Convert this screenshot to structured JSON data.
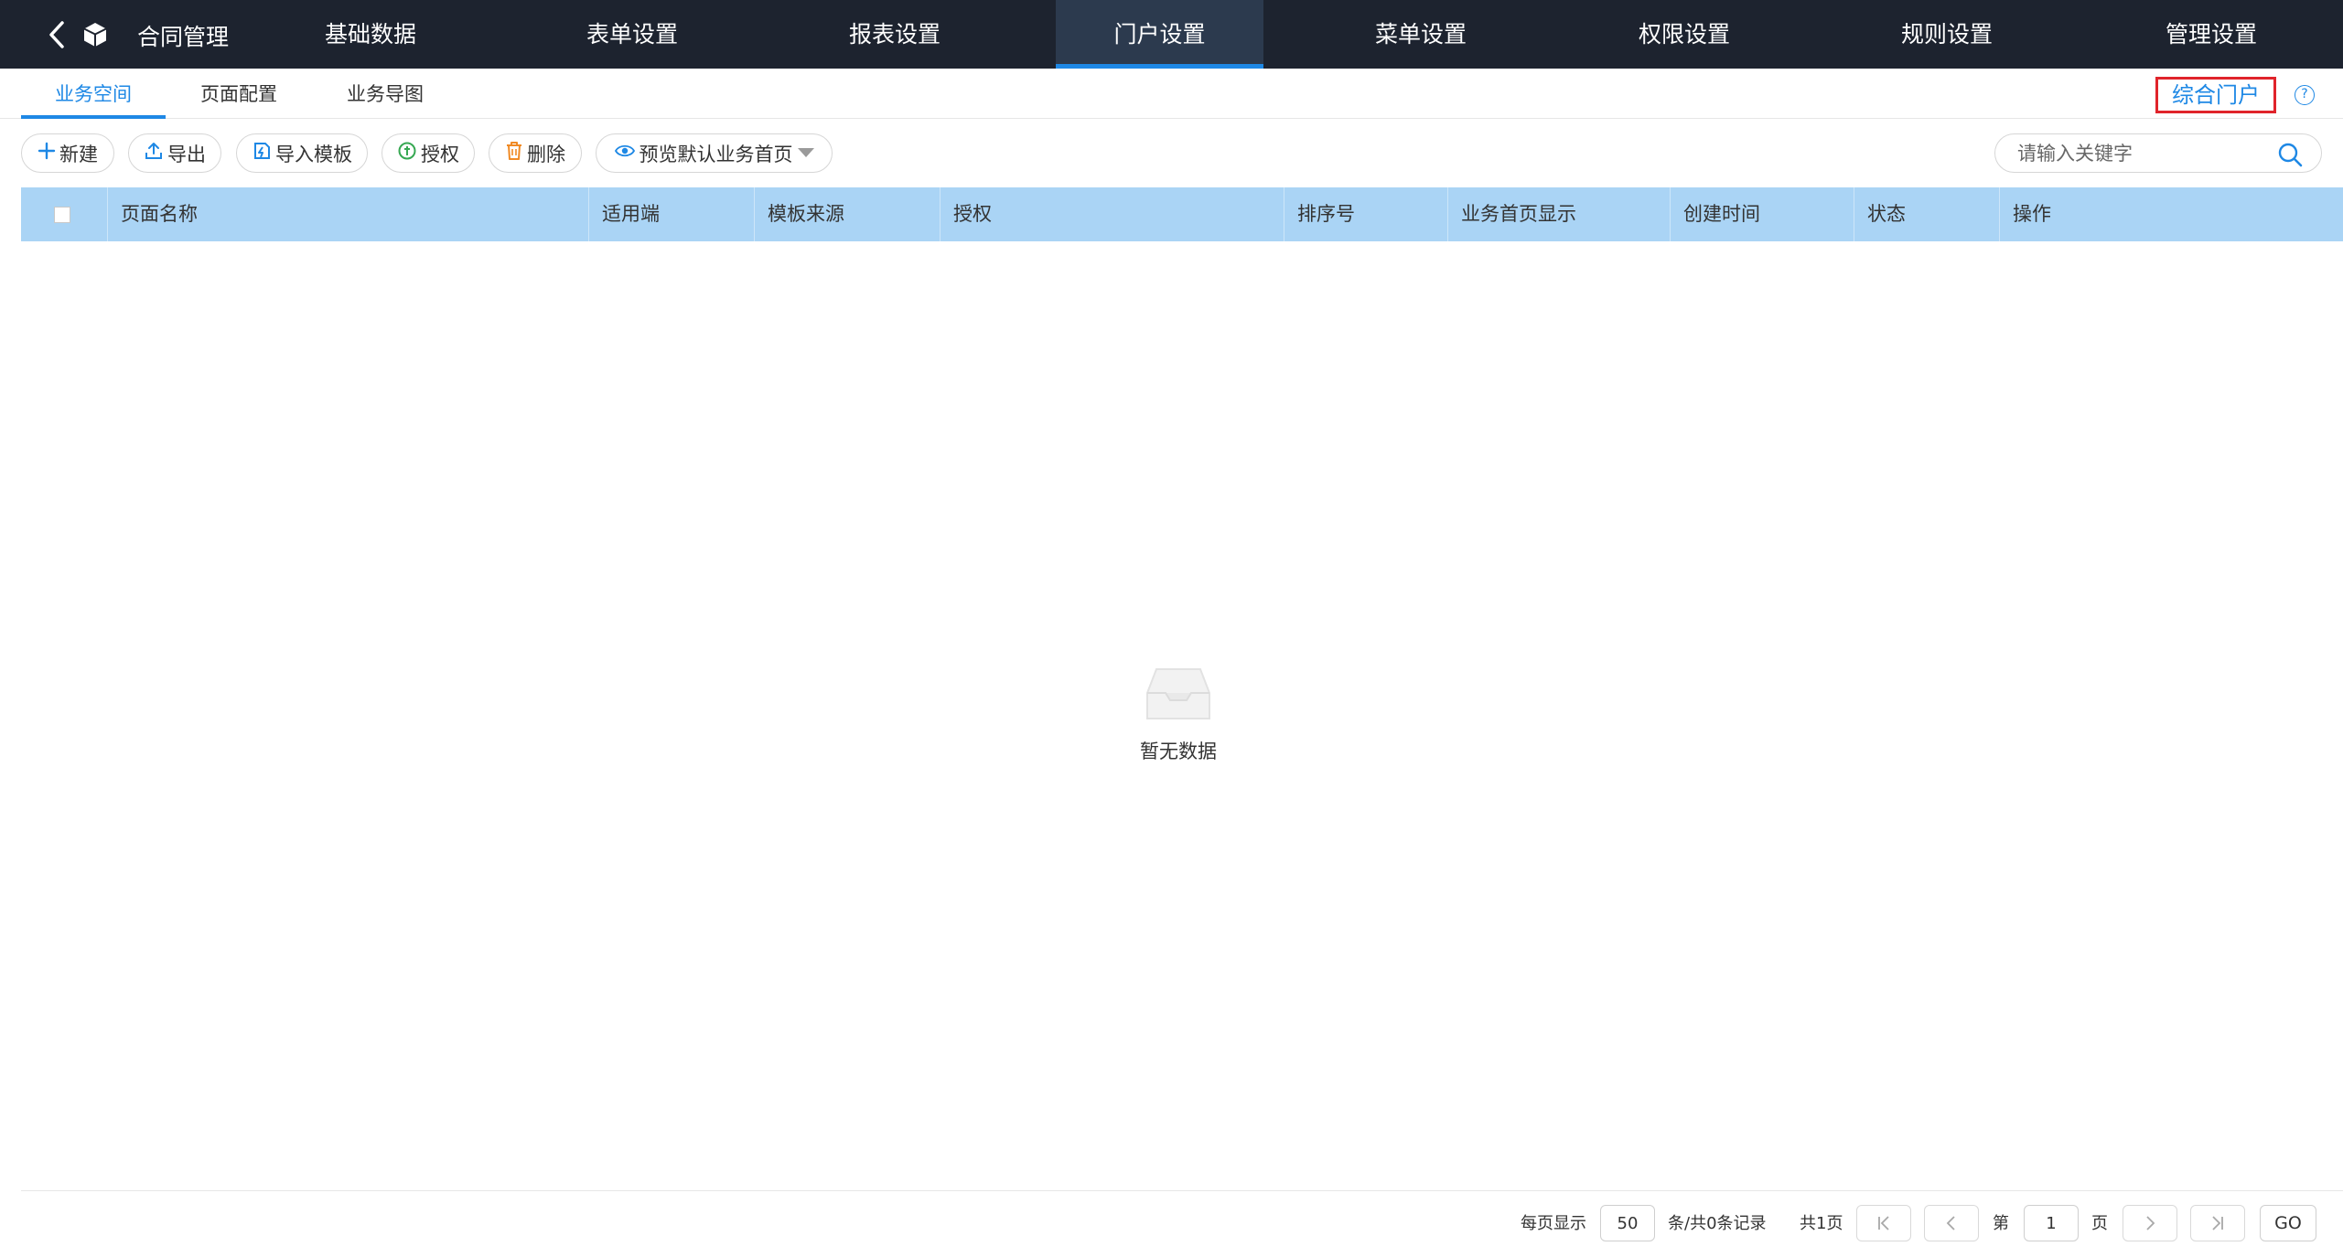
{
  "app": {
    "title": "合同管理"
  },
  "nav": {
    "items": [
      {
        "label": "基础数据"
      },
      {
        "label": "表单设置"
      },
      {
        "label": "报表设置"
      },
      {
        "label": "门户设置",
        "active": true
      },
      {
        "label": "菜单设置"
      },
      {
        "label": "权限设置"
      },
      {
        "label": "规则设置"
      },
      {
        "label": "管理设置"
      }
    ]
  },
  "subtabs": {
    "items": [
      {
        "label": "业务空间",
        "active": true
      },
      {
        "label": "页面配置"
      },
      {
        "label": "业务导图"
      }
    ],
    "portal_link": "综合门户",
    "help_icon": "?"
  },
  "toolbar": {
    "new_label": "新建",
    "export_label": "导出",
    "import_label": "导入模板",
    "auth_label": "授权",
    "delete_label": "删除",
    "preview_label": "预览默认业务首页",
    "search_placeholder": "请输入关键字"
  },
  "table": {
    "columns": [
      "页面名称",
      "适用端",
      "模板来源",
      "授权",
      "排序号",
      "业务首页显示",
      "创建时间",
      "状态",
      "操作"
    ],
    "rows": [],
    "empty_text": "暂无数据"
  },
  "pagination": {
    "per_page_label": "每页显示",
    "per_page_value": "50",
    "records_label": "条/共0条记录",
    "total_pages_label": "共1页",
    "page_prefix": "第",
    "current_page": "1",
    "page_suffix": "页",
    "go_label": "GO"
  },
  "colors": {
    "topbar": "#1d232f",
    "active_nav": "#2c3a4e",
    "accent": "#1e88e5",
    "table_header": "#aad4f5",
    "highlight_border": "#e0242b"
  }
}
